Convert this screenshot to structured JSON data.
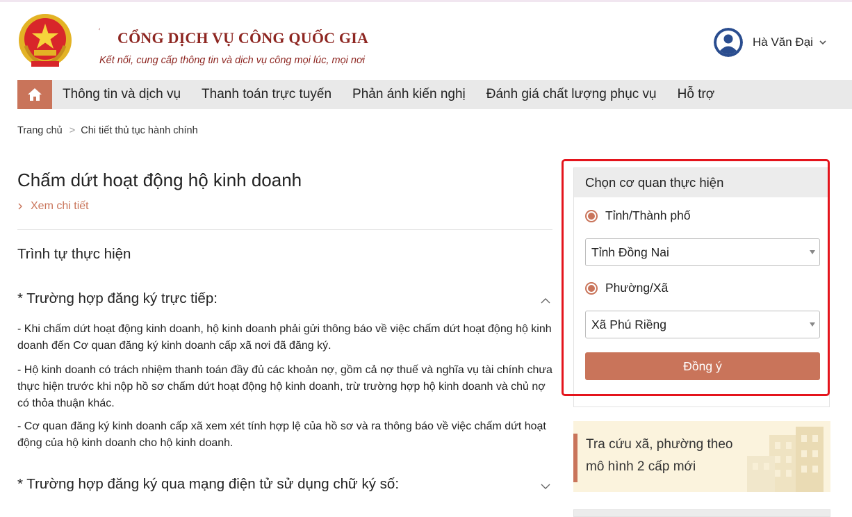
{
  "header": {
    "portal_title": "CỔNG DỊCH VỤ CÔNG QUỐC GIA",
    "portal_subtitle": "Kết nối, cung cấp thông tin và dịch vụ công mọi lúc, mọi nơi",
    "user_name": "Hà Văn Đại"
  },
  "nav": {
    "items": [
      "Thông tin và dịch vụ",
      "Thanh toán trực tuyến",
      "Phản ánh kiến nghị",
      "Đánh giá chất lượng phục vụ",
      "Hỗ trợ"
    ]
  },
  "breadcrumb": {
    "home": "Trang chủ",
    "separator": ">",
    "current": "Chi tiết thủ tục hành chính"
  },
  "main": {
    "title": "Chấm dứt hoạt động hộ kinh doanh",
    "detail_link": "Xem chi tiết",
    "section_title": "Trình tự thực hiện",
    "cases": [
      {
        "title": "* Trường hợp đăng ký trực tiếp:",
        "expanded": true,
        "paragraphs": [
          "- Khi chấm dứt hoạt động kinh doanh, hộ kinh doanh phải gửi thông báo về việc chấm dứt hoạt động hộ kinh doanh đến Cơ quan đăng ký kinh doanh cấp xã nơi đã đăng ký.",
          "- Hộ kinh doanh có trách nhiệm thanh toán đầy đủ các khoản nợ, gồm cả nợ thuế và nghĩa vụ tài chính chưa thực hiện trước khi nộp hồ sơ chấm dứt hoạt động hộ kinh doanh, trừ trường hợp hộ kinh doanh và chủ nợ có thỏa thuận khác.",
          "- Cơ quan đăng ký kinh doanh cấp xã xem xét tính hợp lệ của hồ sơ và ra thông báo về việc chấm dứt hoạt động của hộ kinh doanh cho hộ kinh doanh."
        ]
      },
      {
        "title": "* Trường hợp đăng ký qua mạng điện tử sử dụng chữ ký số:",
        "expanded": false
      }
    ]
  },
  "agency_panel": {
    "title": "Chọn cơ quan thực hiện",
    "province_radio_label": "Tỉnh/Thành phố",
    "province_selected": "Tỉnh Đồng Nai",
    "ward_radio_label": "Phường/Xã",
    "ward_selected": "Xã Phú Riềng",
    "submit_label": "Đồng ý"
  },
  "banner": {
    "line1": "Tra cứu xã, phường theo",
    "line2": "mô hình 2 cấp mới"
  },
  "colors": {
    "accent": "#c9745a",
    "brand_red": "#8e2722",
    "highlight_border": "#e4141c",
    "nav_bg": "#e9e9e9"
  },
  "icons": [
    "national-emblem-icon",
    "user-avatar-icon",
    "chevron-down-icon",
    "home-icon",
    "chevron-right-icon",
    "chevron-up-icon",
    "caret-down-icon",
    "building-icon"
  ]
}
